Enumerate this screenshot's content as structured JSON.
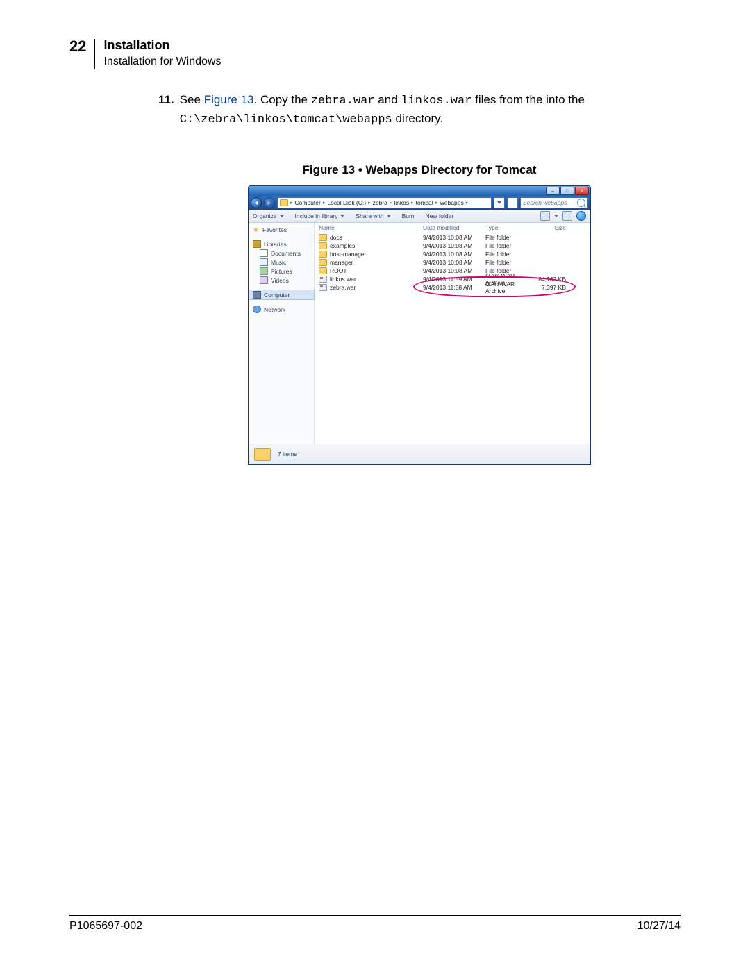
{
  "header": {
    "page_number": "22",
    "section": "Installation",
    "subsection": "Installation for Windows"
  },
  "step": {
    "number": "11.",
    "pre": "See ",
    "link": "Figure 13",
    "mid1": ". Copy the ",
    "code1": "zebra.war",
    "mid2": " and ",
    "code2": "linkos.war",
    "mid3": " files from the into the ",
    "code3": "C:\\zebra\\linkos\\tomcat\\webapps",
    "mid4": " directory."
  },
  "figure_caption": "Figure 13 • Webapps Directory for Tomcat",
  "explorer": {
    "title_buttons": {
      "min": "–",
      "max": "□",
      "close": "×"
    },
    "breadcrumbs": [
      "Computer",
      "Local Disk (C:)",
      "zebra",
      "linkos",
      "tomcat",
      "webapps"
    ],
    "refresh": "↻",
    "search_placeholder": "Search webapps",
    "toolbar": {
      "organize": "Organize",
      "include": "Include in library",
      "share": "Share with",
      "burn": "Burn",
      "newfolder": "New folder"
    },
    "nav": {
      "favorites": "Favorites",
      "libraries": "Libraries",
      "documents": "Documents",
      "music": "Music",
      "pictures": "Pictures",
      "videos": "Videos",
      "computer": "Computer",
      "network": "Network"
    },
    "columns": {
      "name": "Name",
      "date": "Date modified",
      "type": "Type",
      "size": "Size"
    },
    "files": [
      {
        "name": "docs",
        "date": "9/4/2013 10:08 AM",
        "type": "File folder",
        "size": "",
        "icon": "folder"
      },
      {
        "name": "examples",
        "date": "9/4/2013 10:08 AM",
        "type": "File folder",
        "size": "",
        "icon": "folder"
      },
      {
        "name": "host-manager",
        "date": "9/4/2013 10:08 AM",
        "type": "File folder",
        "size": "",
        "icon": "folder"
      },
      {
        "name": "manager",
        "date": "9/4/2013 10:08 AM",
        "type": "File folder",
        "size": "",
        "icon": "folder"
      },
      {
        "name": "ROOT",
        "date": "9/4/2013 10:08 AM",
        "type": "File folder",
        "size": "",
        "icon": "folder"
      },
      {
        "name": "linkos.war",
        "date": "9/4/2013 11:59 AM",
        "type": "IZArc WAR Archive",
        "size": "84,162 KB",
        "icon": "war"
      },
      {
        "name": "zebra.war",
        "date": "9/4/2013 11:58 AM",
        "type": "IZArc WAR Archive",
        "size": "7,397 KB",
        "icon": "war"
      }
    ],
    "status": "7 items"
  },
  "footer": {
    "left": "P1065697-002",
    "right": "10/27/14"
  }
}
